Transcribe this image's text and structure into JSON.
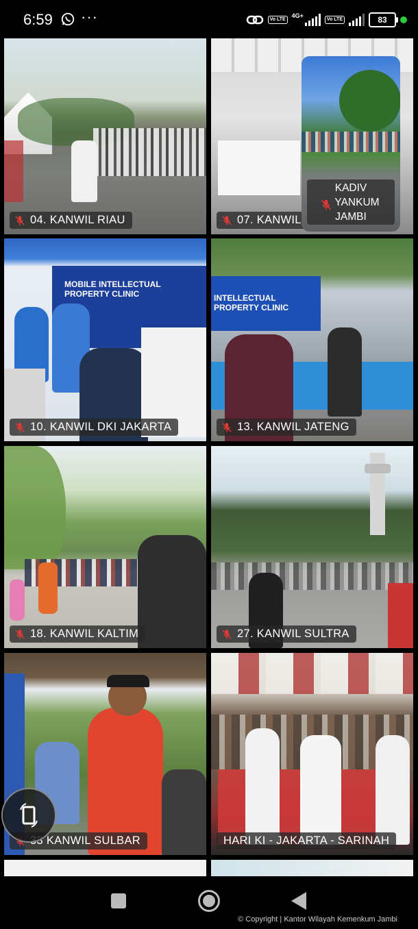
{
  "status_bar": {
    "time": "6:59",
    "more": "···",
    "network": "4G+",
    "volte1": "Vo LTE",
    "volte2": "Vo LTE",
    "battery": "83"
  },
  "tiles": [
    {
      "label": "04. KANWIL RIAU",
      "muted": true
    },
    {
      "label": "07. KANWIL",
      "muted": true
    },
    {
      "label": "10. KANWIL DKI JAKARTA",
      "muted": true
    },
    {
      "label": "13. KANWIL JATENG",
      "muted": true
    },
    {
      "label": "18. KANWIL KALTIM",
      "muted": true
    },
    {
      "label": "27. KANWIL SULTRA",
      "muted": true
    },
    {
      "label": "33 KANWIL SULBAR",
      "muted": true
    },
    {
      "label": "HARI KI - JAKARTA - SARINAH",
      "muted": false,
      "active_speaker": true
    }
  ],
  "self_view": {
    "line1": "KADIV",
    "line2": "YANKUM",
    "line3": "JAMBI",
    "muted": true
  },
  "banners": {
    "dki": "MOBILE INTELLECTUAL PROPERTY CLINIC",
    "jateng": "INTELLECTUAL PROPERTY CLINIC"
  },
  "footer": {
    "copyright": "© Copyright | Kantor Wilayah Kemenkum Jambi"
  },
  "colors": {
    "active_border": "#2db84b",
    "label_bg": "#282828",
    "mute_icon": "#e53935"
  }
}
